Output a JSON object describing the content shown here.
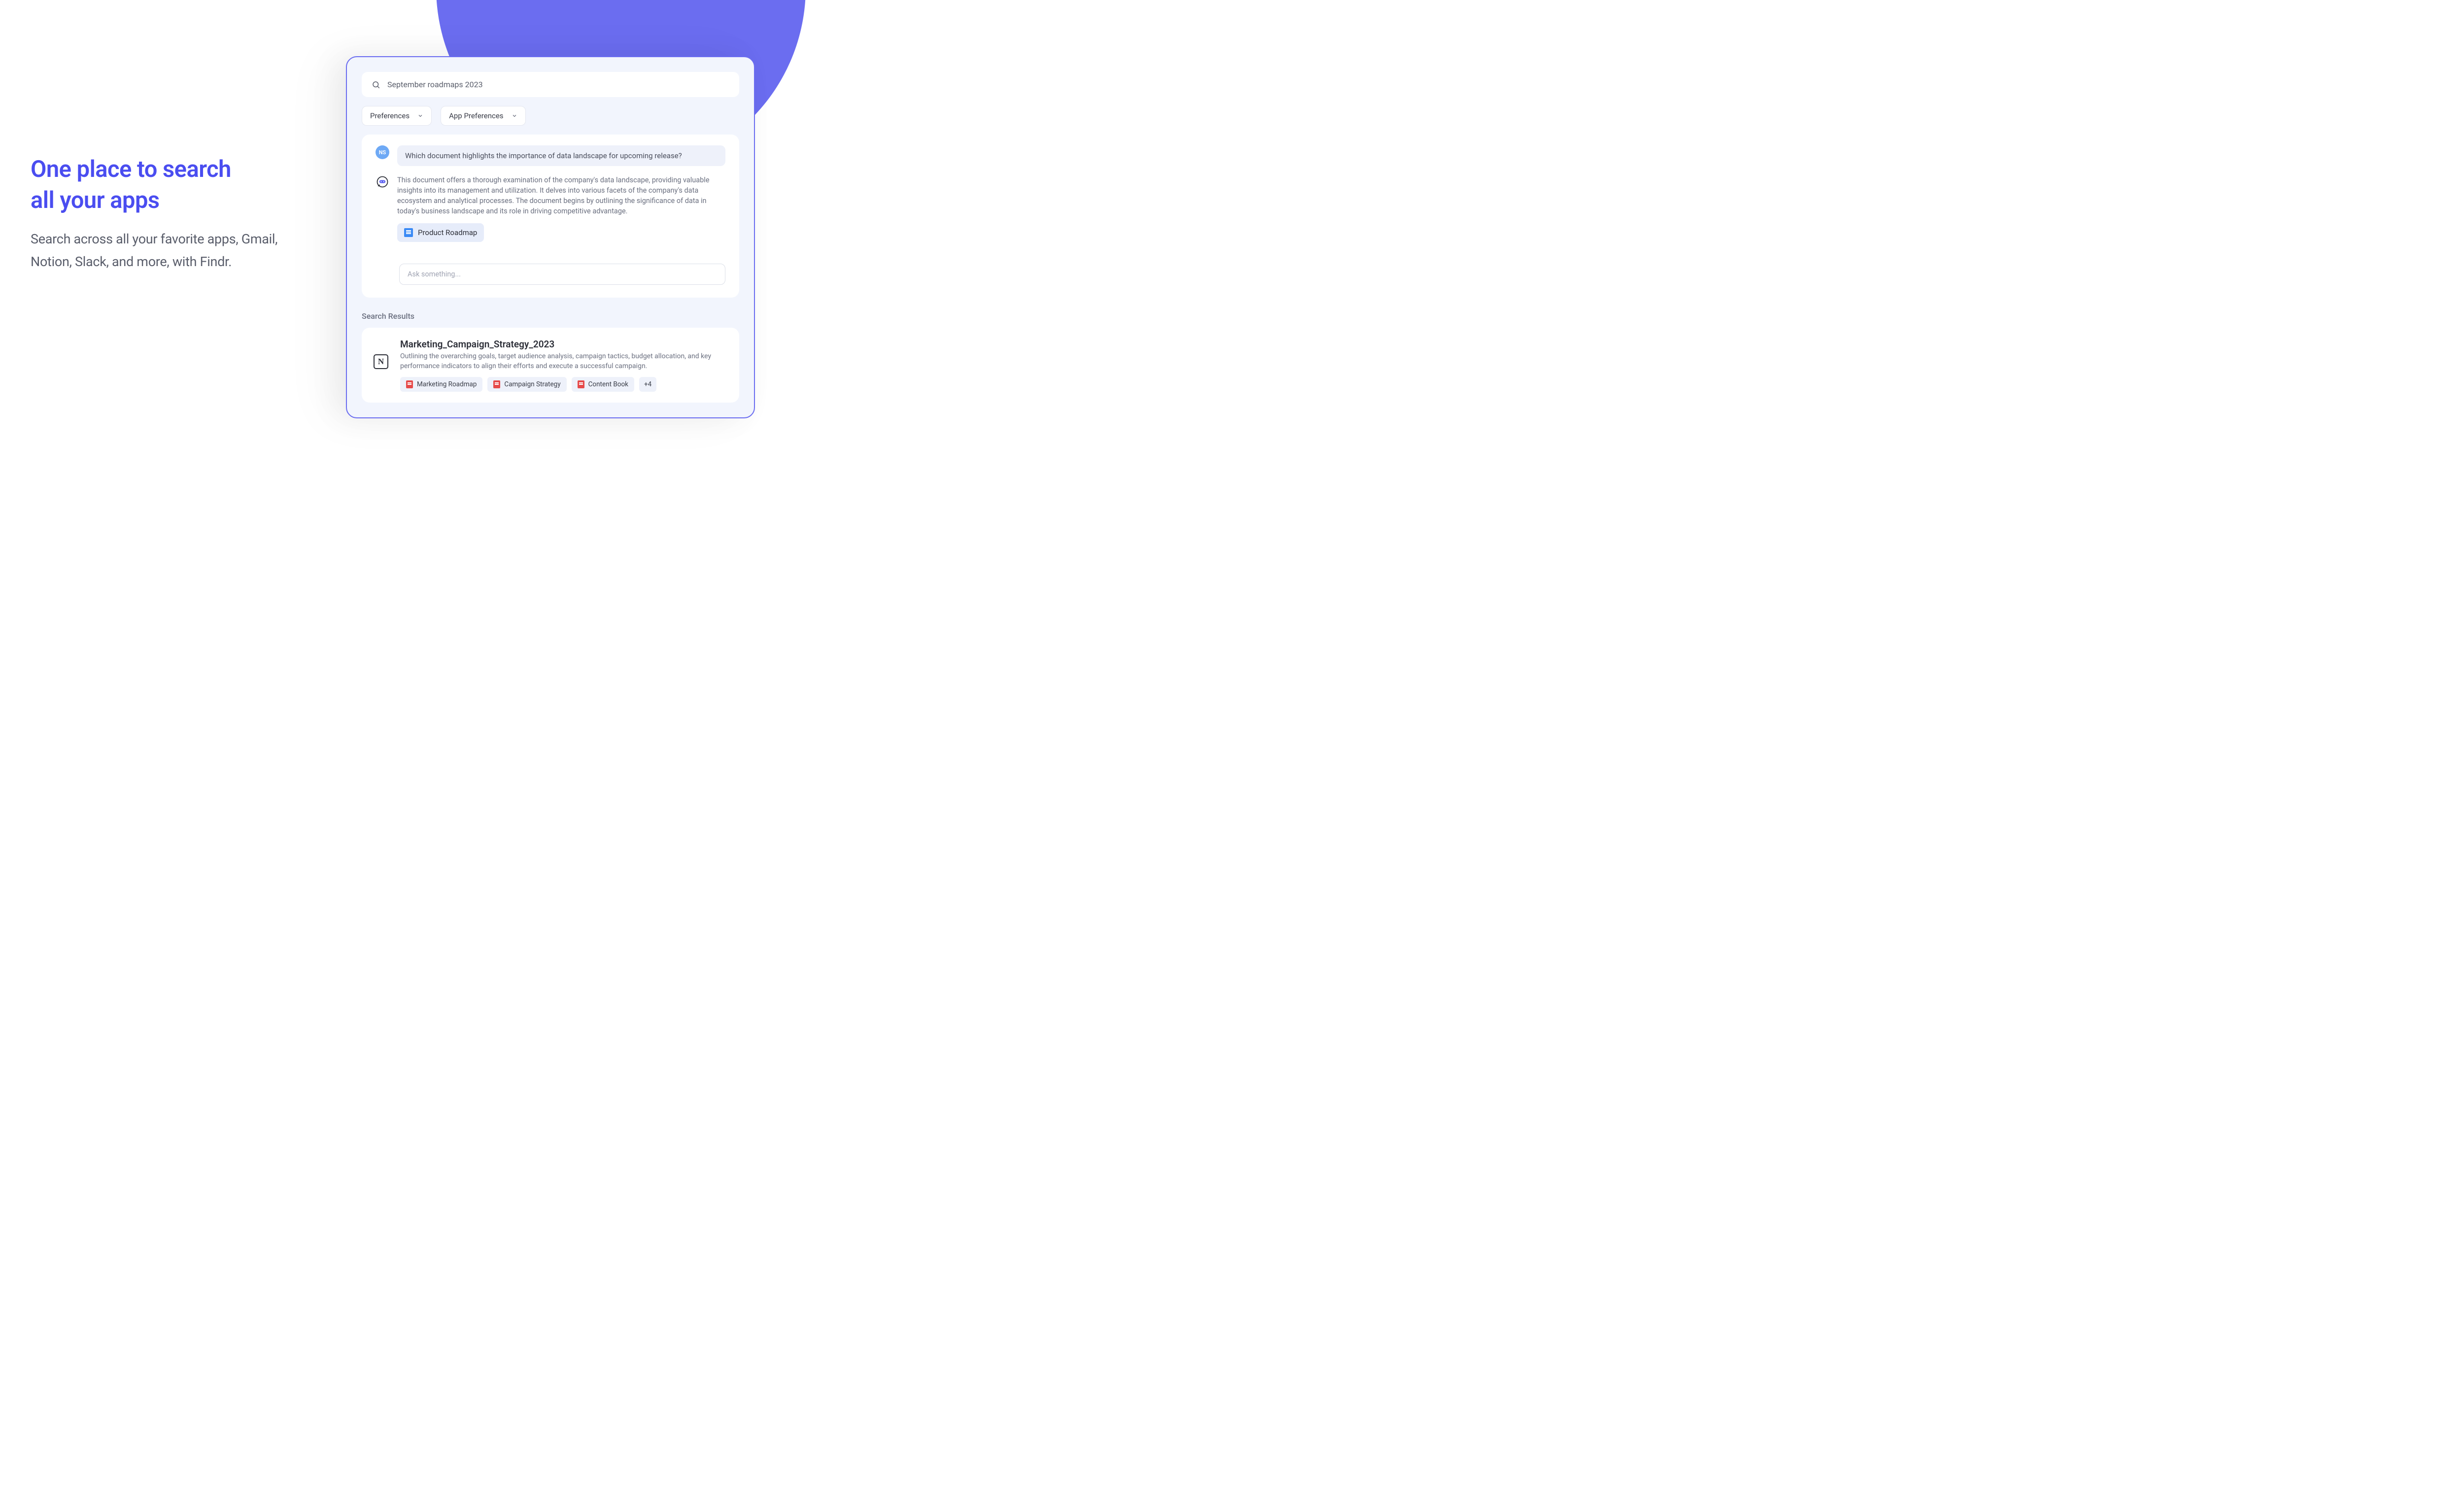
{
  "hero": {
    "title_line1": "One place to search",
    "title_line2": "all your apps",
    "subtitle": "Search across all your favorite apps, Gmail, Notion, Slack, and more, with Findr."
  },
  "search": {
    "query": "September roadmaps 2023"
  },
  "filters": {
    "preferences": "Preferences",
    "app_preferences": "App Preferences"
  },
  "chat": {
    "user_initials": "NS",
    "user_message": "Which document highlights the importance of data landscape for upcoming release?",
    "bot_response": "This document offers a thorough examination of the company's data landscape, providing valuable insights into its management and utilization. It delves into various facets of the company's data ecosystem and analytical processes. The document begins by outlining the significance of data in today's business landscape and its role in driving competitive advantage.",
    "doc_chip": "Product Roadmap",
    "ask_placeholder": "Ask something..."
  },
  "results": {
    "heading": "Search Results",
    "items": [
      {
        "title": "Marketing_Campaign_Strategy_2023",
        "description": "Outlining the overarching goals, target audience analysis, campaign tactics, budget allocation, and key performance indicators to align their efforts and execute a successful campaign.",
        "files": [
          "Marketing Roadmap",
          "Campaign Strategy",
          "Content Book"
        ],
        "more": "+4"
      }
    ]
  }
}
